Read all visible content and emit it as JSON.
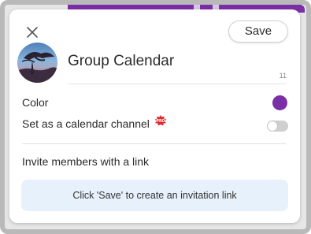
{
  "header": {
    "save_label": "Save",
    "close_icon": "close-icon"
  },
  "calendar": {
    "name": "Group Calendar",
    "char_count": "11",
    "avatar_icon": "calendar-avatar-image"
  },
  "settings": {
    "color_label": "Color",
    "color_value": "#7b2fa6",
    "channel_label": "Set as a calendar channel",
    "pro_badge": "PRO",
    "channel_enabled": false
  },
  "invite": {
    "label": "Invite members with a link",
    "hint": "Click 'Save' to create an invitation link"
  },
  "colors": {
    "accent": "#7b2fa6",
    "info_bg": "#e7f1fb",
    "badge": "#e0282e"
  }
}
